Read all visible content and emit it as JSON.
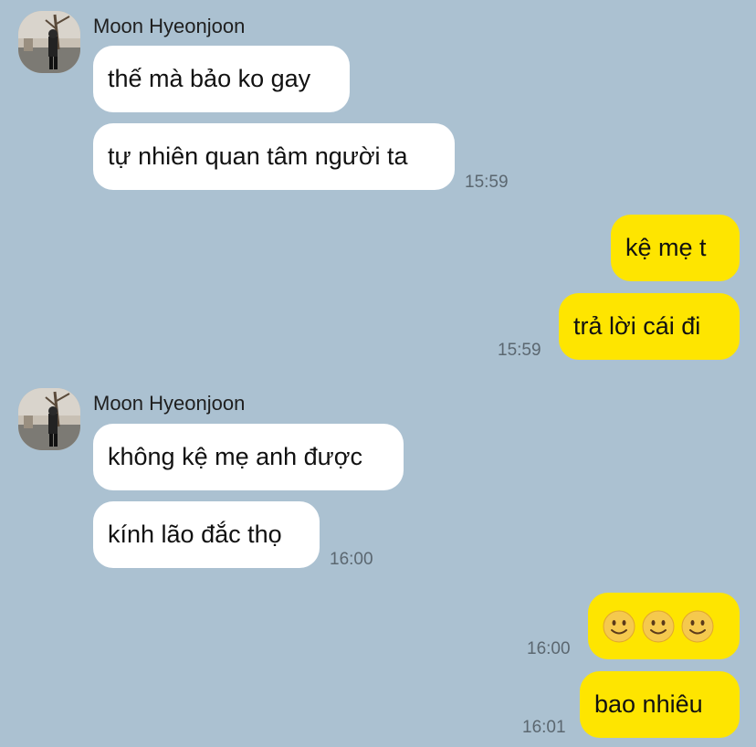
{
  "contact": {
    "name": "Moon Hyeonjoon"
  },
  "groups": [
    {
      "sender": "Moon Hyeonjoon",
      "messages": [
        "thế mà bảo ko gay",
        "tự nhiên quan tâm người ta"
      ],
      "time": "15:59"
    },
    {
      "sender": "me",
      "messages": [
        "kệ mẹ t",
        "trả lời cái đi"
      ],
      "time": "15:59"
    },
    {
      "sender": "Moon Hyeonjoon",
      "messages": [
        "không kệ mẹ anh được",
        "kính lão đắc thọ"
      ],
      "time": "16:00"
    },
    {
      "sender": "me",
      "messages": [
        "smiley-emoji x3"
      ],
      "time": "16:00"
    },
    {
      "sender": "me",
      "messages": [
        "bao nhiêu"
      ],
      "time": "16:01"
    }
  ],
  "colors": {
    "background": "#abc1d1",
    "incoming_bubble": "#ffffff",
    "outgoing_bubble": "#fee500"
  },
  "icons": {
    "emoji": "slightly-smiling-face-emoji"
  }
}
